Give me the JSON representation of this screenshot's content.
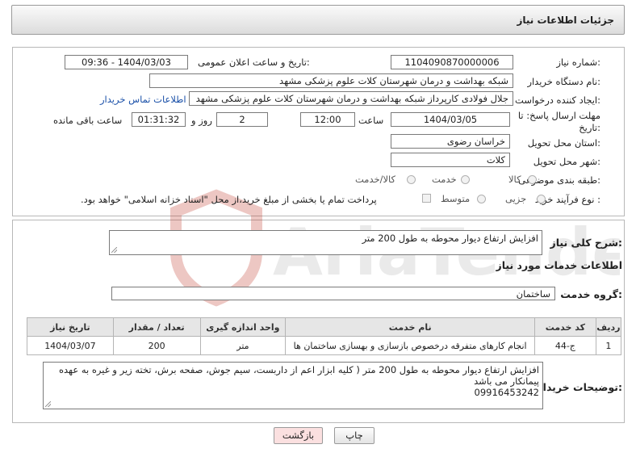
{
  "header": {
    "title": "جزئیات اطلاعات نیاز"
  },
  "form": {
    "need_number_label": "شماره نیاز:",
    "need_number": "1104090870000006",
    "announce_label": "تاریخ و ساعت اعلان عمومی:",
    "announce_value": "1404/03/03 - 09:36",
    "buyer_label": "نام دستگاه خریدار:",
    "buyer_value": "شبکه بهداشت و درمان شهرستان کلات   علوم پزشکی مشهد",
    "creator_label": "ایجاد کننده درخواست:",
    "creator_value": "جلال فولادی کارپرداز شبکه بهداشت و درمان شهرستان کلات   علوم پزشکی مشهد",
    "contact_link": "اطلاعات تماس خریدار",
    "deadline_label": "مهلت ارسال پاسخ: تا",
    "deadline_label2": "تاریخ:",
    "deadline_date": "1404/03/05",
    "time_label": "ساعت",
    "deadline_time": "12:00",
    "days_value": "2",
    "days_label": "روز و",
    "remaining_value": "01:31:32",
    "remaining_label": "ساعت باقی مانده",
    "province_label": "استان محل تحویل:",
    "province_value": "خراسان رضوی",
    "city_label": "شهر محل تحویل:",
    "city_value": "کلات",
    "category_label": "طبقه بندی موضوعی:",
    "category_options": [
      "کالا",
      "خدمت",
      "کالا/خدمت"
    ],
    "process_label": "نوع فرآیند خرید :",
    "process_options": [
      "جزیی",
      "متوسط"
    ],
    "payment_note": "پرداخت تمام یا بخشی از مبلغ خرید،از محل \"اسناد خزانه اسلامی\" خواهد بود."
  },
  "summary": {
    "label": "شرح کلی نیاز:",
    "value": "افزایش ارتفاع دیوار محوطه به طول 200 متر",
    "services_title": "اطلاعات خدمات مورد نیاز",
    "group_label": "گروه خدمت:",
    "group_value": "ساختمان"
  },
  "table": {
    "columns": [
      "ردیف",
      "کد خدمت",
      "نام خدمت",
      "واحد اندازه گیری",
      "تعداد / مقدار",
      "تاریخ نیاز"
    ],
    "rows": [
      [
        "1",
        "ج-44",
        "انجام کارهای متفرقه درخصوص بازسازی و بهسازی ساختمان ها",
        "متر",
        "200",
        "1404/03/07"
      ]
    ]
  },
  "buyer_notes": {
    "label": "توضیحات خریدار:",
    "line1": "افزایش ارتفاع دیوار محوطه به طول 200 متر ( کلیه ابزار اعم از داربست، سیم جوش، صفحه برش، تخته زیر و غیره به عهده",
    "line2": "پیمانکار می باشد",
    "line3": "09916453242"
  },
  "buttons": {
    "print": "چاپ",
    "back": "بازگشت"
  },
  "watermark": {
    "text": "AriaTender.net"
  },
  "colors": {
    "link": "#1a50a8",
    "back_button": "#fbe0e0",
    "watermark": "#c0392b"
  }
}
